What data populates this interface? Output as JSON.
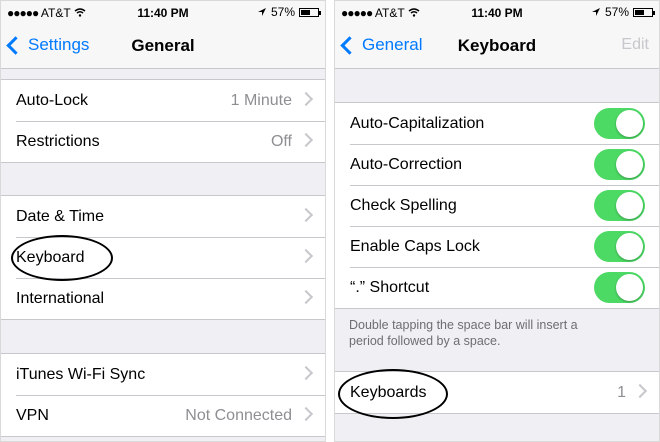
{
  "left": {
    "status": {
      "carrier": "AT&T",
      "time": "11:40 PM",
      "battery": "57%"
    },
    "nav": {
      "back_label": "Settings",
      "title": "General"
    },
    "group1": [
      {
        "label": "Auto-Lock",
        "value": "1 Minute"
      },
      {
        "label": "Restrictions",
        "value": "Off"
      }
    ],
    "group2": [
      {
        "label": "Date & Time"
      },
      {
        "label": "Keyboard"
      },
      {
        "label": "International"
      }
    ],
    "group3": [
      {
        "label": "iTunes Wi-Fi Sync"
      },
      {
        "label": "VPN",
        "value": "Not Connected"
      }
    ]
  },
  "right": {
    "status": {
      "carrier": "AT&T",
      "time": "11:40 PM",
      "battery": "57%"
    },
    "nav": {
      "back_label": "General",
      "title": "Keyboard",
      "edit_label": "Edit"
    },
    "toggles": [
      {
        "label": "Auto-Capitalization",
        "on": true
      },
      {
        "label": "Auto-Correction",
        "on": true
      },
      {
        "label": "Check Spelling",
        "on": true
      },
      {
        "label": "Enable Caps Lock",
        "on": true
      },
      {
        "label": "“.” Shortcut",
        "on": true
      }
    ],
    "footnote": "Double tapping the space bar will insert a period followed by a space.",
    "keyboards": {
      "label": "Keyboards",
      "value": "1"
    }
  },
  "colors": {
    "accent": "#007aff",
    "toggle_on": "#4cd964",
    "background": "#efeff4"
  }
}
